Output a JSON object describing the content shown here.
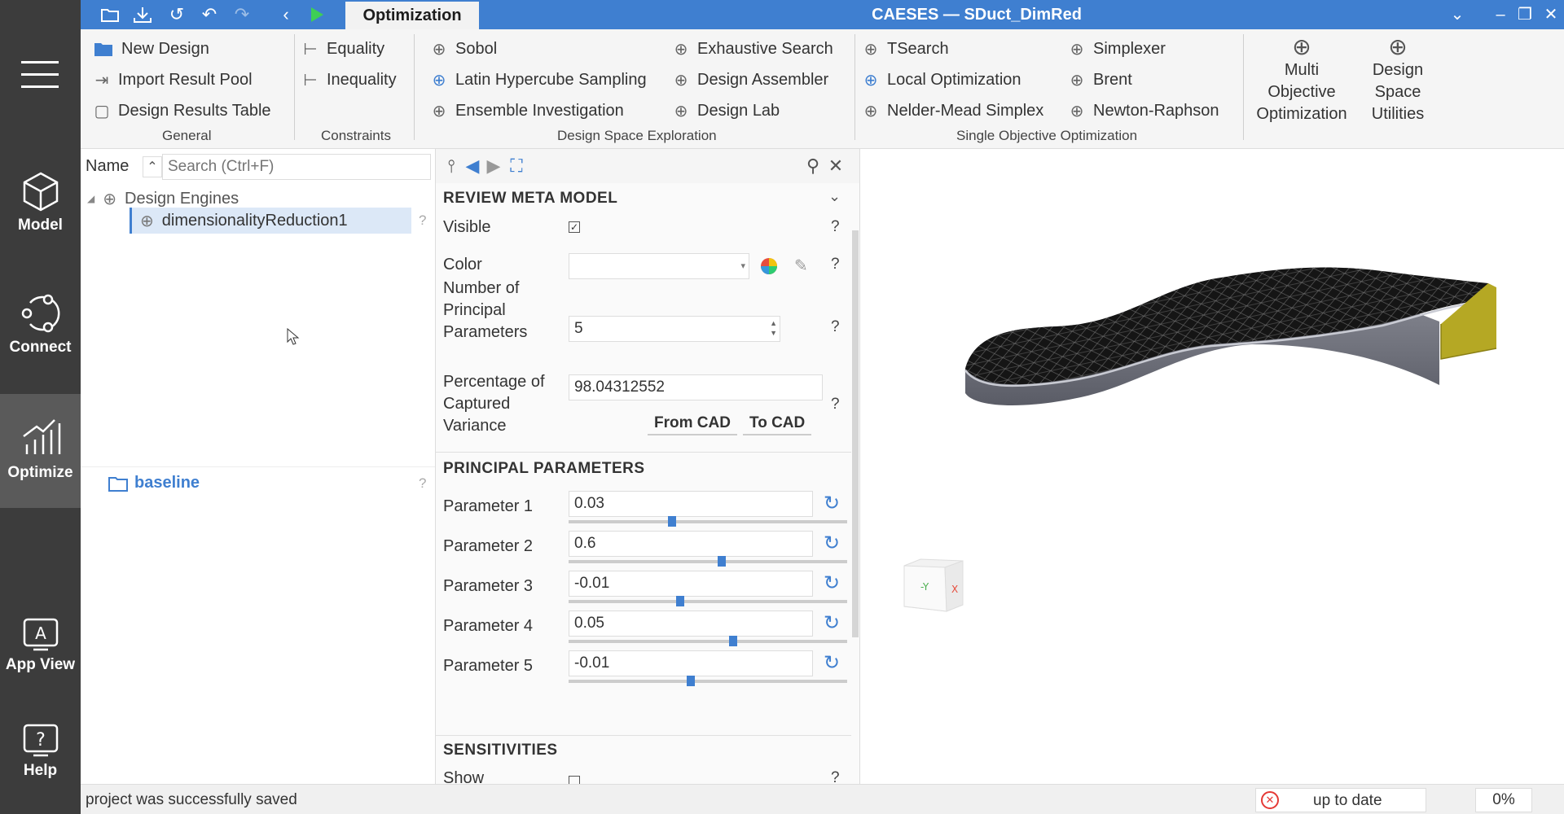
{
  "app": {
    "title": "CAESES — SDuct_DimRed",
    "active_tab": "Optimization"
  },
  "sidebar": {
    "items": [
      {
        "label": "Model",
        "icon": "cube-icon"
      },
      {
        "label": "Connect",
        "icon": "connect-icon"
      },
      {
        "label": "Optimize",
        "icon": "optimize-icon",
        "active": true
      },
      {
        "label": "App View",
        "icon": "app-view-icon"
      },
      {
        "label": "Help",
        "icon": "help-icon"
      }
    ]
  },
  "ribbon": {
    "general": {
      "label": "General",
      "items": [
        "New Design",
        "Import Result Pool",
        "Design Results Table"
      ]
    },
    "constraints": {
      "label": "Constraints",
      "items": [
        "Equality",
        "Inequality"
      ]
    },
    "dse": {
      "label": "Design Space Exploration",
      "col1": [
        "Sobol",
        "Latin Hypercube Sampling",
        "Ensemble Investigation"
      ],
      "col2": [
        "Exhaustive Search",
        "Design Assembler",
        "Design Lab"
      ]
    },
    "soo": {
      "label": "Single Objective Optimization",
      "col1": [
        "TSearch",
        "Local Optimization",
        "Nelder-Mead Simplex"
      ],
      "col2": [
        "Simplexer",
        "Brent",
        "Newton-Raphson"
      ]
    },
    "multi": {
      "line1": "Multi",
      "line2": "Objective",
      "line3": "Optimization"
    },
    "dsu": {
      "line1": "Design",
      "line2": "Space",
      "line3": "Utilities"
    }
  },
  "tree": {
    "name_label": "Name",
    "search_placeholder": "Search (Ctrl+F)",
    "root": "Design Engines",
    "child": "dimensionalityReduction1",
    "baseline": "baseline",
    "qmark": "?"
  },
  "props": {
    "review_title": "REVIEW META MODEL",
    "visible_label": "Visible",
    "color_label": "Color",
    "num_pp_label": [
      "Number of",
      "Principal",
      "Parameters"
    ],
    "num_pp_value": "5",
    "pct_label": [
      "Percentage of",
      "Captured",
      "Variance"
    ],
    "pct_value": "98.04312552",
    "from_cad": "From CAD",
    "to_cad": "To CAD",
    "pp_title": "PRINCIPAL PARAMETERS",
    "parameters": [
      {
        "label": "Parameter 1",
        "value": "0.03",
        "slider": 0.37
      },
      {
        "label": "Parameter 2",
        "value": "0.6",
        "slider": 0.55
      },
      {
        "label": "Parameter 3",
        "value": "-0.01",
        "slider": 0.4
      },
      {
        "label": "Parameter 4",
        "value": "0.05",
        "slider": 0.59
      },
      {
        "label": "Parameter 5",
        "value": "-0.01",
        "slider": 0.44
      }
    ],
    "sens_title": "SENSITIVITIES",
    "show_label": "Show",
    "qmark": "?"
  },
  "status": {
    "message": "project was successfully saved",
    "state": "up to date",
    "percent": "0%"
  },
  "colors": {
    "accent": "#3f7fd0",
    "sidebar": "#3c3c3c",
    "duct_end": "#b5a824"
  }
}
